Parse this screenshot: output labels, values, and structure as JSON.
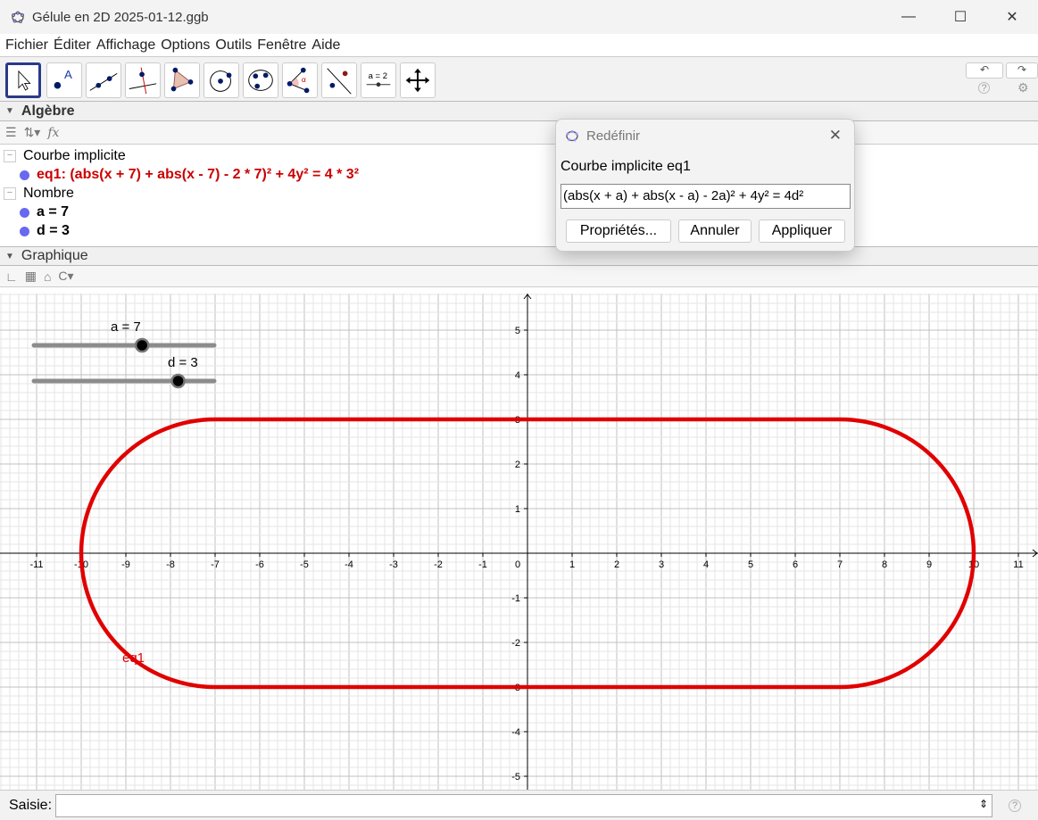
{
  "window": {
    "title": "Gélule en 2D 2025-01-12.ggb",
    "minimize": "—",
    "maximize": "☐",
    "close": "✕"
  },
  "menu": [
    "Fichier",
    "Éditer",
    "Affichage",
    "Options",
    "Outils",
    "Fenêtre",
    "Aide"
  ],
  "toolbar": {
    "tools": [
      "move",
      "point",
      "line",
      "perpendicular",
      "polygon",
      "circle",
      "conic",
      "angle",
      "reflect",
      "slider",
      "move-graphics"
    ],
    "slider_tool_label": "a = 2",
    "undo": "↶",
    "redo": "↷",
    "help": "?",
    "settings": "⚙"
  },
  "algebra": {
    "title": "Algèbre",
    "fx": "fx",
    "groups": [
      {
        "name": "Courbe implicite",
        "items": [
          {
            "text": "eq1: (abs(x + 7) + abs(x - 7) - 2 * 7)² + 4y² = 4 * 3²",
            "color": "#cc0000"
          }
        ]
      },
      {
        "name": "Nombre",
        "items": [
          {
            "text": "a = 7",
            "color": "#000000"
          },
          {
            "text": "d = 3",
            "color": "#000000"
          }
        ]
      }
    ]
  },
  "graphics": {
    "title": "Graphique",
    "curve_label": "eq1",
    "curve_color": "#e00000",
    "sliders": [
      {
        "label": "a = 7",
        "value": 7,
        "min": -5,
        "max": 15
      },
      {
        "label": "d = 3",
        "value": 3,
        "min": -5,
        "max": 5
      }
    ],
    "params": {
      "a": 7,
      "d": 3
    },
    "x_ticks": [
      -11,
      -10,
      -9,
      -8,
      -7,
      -6,
      -5,
      -4,
      -3,
      -2,
      -1,
      0,
      1,
      2,
      3,
      4,
      5,
      6,
      7,
      8,
      9,
      10,
      11
    ],
    "y_ticks": [
      -5,
      -4,
      -3,
      -2,
      -1,
      1,
      2,
      3,
      4,
      5
    ]
  },
  "input": {
    "label": "Saisie:",
    "value": "",
    "help": "?"
  },
  "dialog": {
    "title": "Redéfinir",
    "subtitle": "Courbe implicite eq1",
    "value": "(abs(x + a) + abs(x - a) - 2a)² + 4y² = 4d²",
    "buttons": [
      "Propriétés...",
      "Annuler",
      "Appliquer"
    ],
    "close": "✕"
  }
}
